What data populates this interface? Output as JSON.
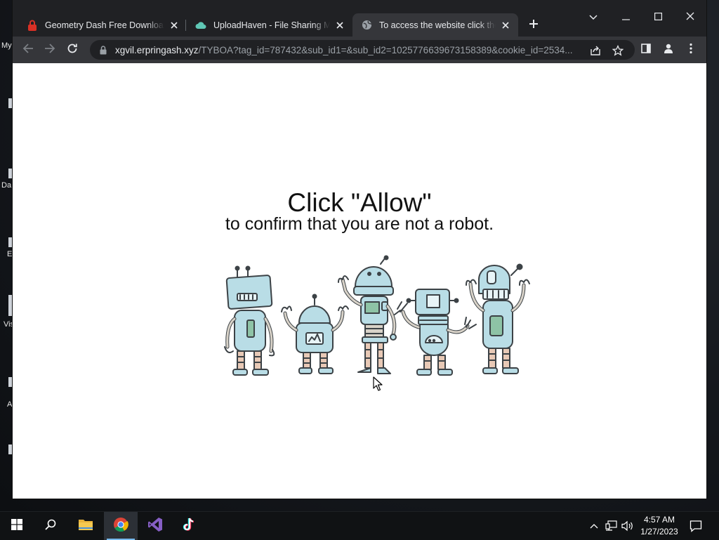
{
  "desktop": {
    "icon_labels": [
      "My",
      "Da",
      "E",
      "Vis",
      "A"
    ]
  },
  "browser": {
    "tabs": [
      {
        "title": "Geometry Dash Free Download (",
        "favicon": "red-lock-icon",
        "active": false
      },
      {
        "title": "UploadHaven - File Sharing Mad",
        "favicon": "cloud-icon",
        "active": false
      },
      {
        "title": "To access the website click the \"A",
        "favicon": "globe-icon",
        "active": true
      }
    ],
    "address": {
      "host": "xgvil.erpringash.xyz",
      "path": "/TYBOA?tag_id=787432&sub_id1=&sub_id2=1025776639673158389&cookie_id=2534..."
    },
    "page": {
      "headline": "Click \"Allow\"",
      "subline": "to confirm that you are not a robot.",
      "illustration": "five-cartoon-robots"
    }
  },
  "taskbar": {
    "apps": [
      "start-icon",
      "search-icon",
      "file-explorer-icon",
      "chrome-icon",
      "visual-studio-icon",
      "tiktok-icon"
    ],
    "time": "4:57 AM",
    "date": "1/27/2023"
  },
  "colors": {
    "browser_frame": "#202124",
    "toolbar": "#35363a",
    "robot_fill": "#b9dde6",
    "robot_stroke": "#3c4246"
  }
}
